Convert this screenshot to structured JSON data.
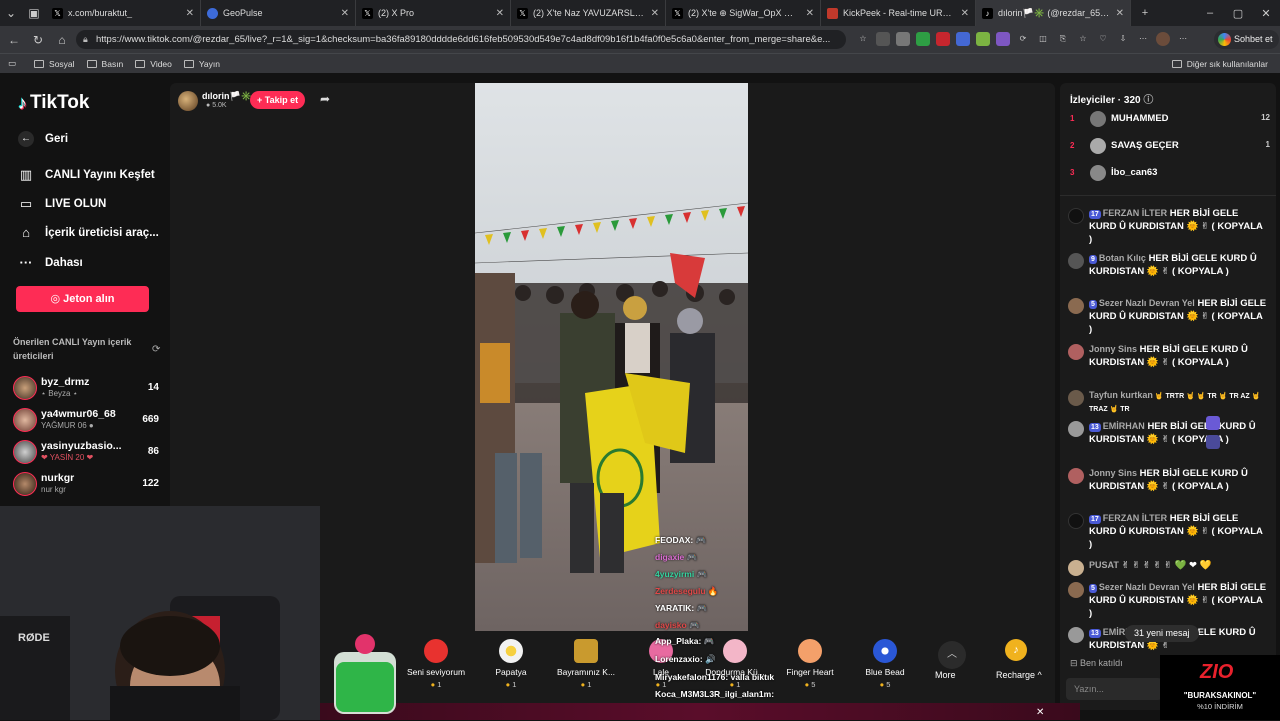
{
  "browser": {
    "tabs": [
      {
        "title": "x.com/buraktut_",
        "icon": "x-icon"
      },
      {
        "title": "GeoPulse",
        "icon": "globe-icon"
      },
      {
        "title": "(2) X Pro",
        "icon": "x-icon"
      },
      {
        "title": "(2) X'te Naz YAVUZARSLAN: \"CH",
        "icon": "x-icon"
      },
      {
        "title": "(2) X'te ⊕ SigWar_OpX ⊕ Δ: \"Ca",
        "icon": "x-icon"
      },
      {
        "title": "KickPeek - Real-time URL Crawle",
        "icon": "kickpeek-icon"
      },
      {
        "title": "dılorin🏳️✳️ (@rezdar_65) C",
        "icon": "tiktok-icon",
        "active": true
      }
    ],
    "url": "https://www.tiktok.com/@rezdar_65/live?_r=1&_sig=1&checksum=ba36fa89180dddde6dd616feb509530d549e7c4ad8df09b16f1b4fa0f0e5c6a0&enter_from_merge=share&e...",
    "chat_button": "Sohbet et",
    "bookmarks": [
      "Sosyal",
      "Basın",
      "Video",
      "Yayın"
    ],
    "other_bookmarks": "Diğer sık kullanılanlar"
  },
  "sidebar": {
    "logo": "TikTok",
    "items": [
      {
        "label": "Geri",
        "icon": "arrow-left-icon"
      },
      {
        "label": "CANLI Yayını Keşfet",
        "icon": "live-explore-icon"
      },
      {
        "label": "LIVE OLUN",
        "icon": "video-camera-icon"
      },
      {
        "label": "İçerik üreticisi araç...",
        "icon": "home-creator-icon"
      },
      {
        "label": "Dahası",
        "icon": "more-dots-icon"
      }
    ],
    "jeton_button": "Jeton alın",
    "suggest_title": "Önerilen CANLI Yayın içerik üreticileri",
    "creators": [
      {
        "name": "byz_drmz",
        "sub": "⋆ Beyza ⋆",
        "count": "14"
      },
      {
        "name": "ya4wmur06_68",
        "sub": "YAĞMUR 06 ●",
        "count": "669"
      },
      {
        "name": "yasinyuzbasio...",
        "sub": "❤ YASİN 20 ❤",
        "count": "86"
      },
      {
        "name": "nurkgr",
        "sub": "nur kgr",
        "count": "122"
      }
    ]
  },
  "stream": {
    "host_name": "dılorin🏳️✳️",
    "host_viewers": "5.0K",
    "follow_button": "+ Takip et",
    "video_chat": [
      {
        "text": "FEODAX: 🎮",
        "color": "#ffffff"
      },
      {
        "text": "digaxie 🎮",
        "color": "#d86ad0"
      },
      {
        "text": "4yuzyirmi 🎮",
        "color": "#34d3a0"
      },
      {
        "text": "Zerdesegulu 🔥",
        "color": "#e04848"
      },
      {
        "text": "YARATIK: 🎮",
        "color": "#ffffff"
      },
      {
        "text": "dayisko 🎮",
        "color": "#e04848"
      },
      {
        "text": "App_Plaka: 🎮",
        "color": "#ffffff"
      },
      {
        "text": "Lorenzaxio: 🔊",
        "color": "#ffffff"
      },
      {
        "text": "Miryakefalon1176: valla bıktık",
        "color": "#ffffff"
      },
      {
        "text": "Koca_M3M3L3R_ilgi_alan1m:",
        "color": "#ffffff"
      }
    ],
    "gifts": [
      {
        "name": "Seni seviyorum",
        "price": "1",
        "color": "#e8322f"
      },
      {
        "name": "Papatya",
        "price": "1",
        "color": "#f2f2f2"
      },
      {
        "name": "Bayramınız K...",
        "price": "1",
        "color": "#c99a2e"
      },
      {
        "name": "Lale",
        "price": "1",
        "color": "#e86aa0"
      },
      {
        "name": "Dondurma Kü...",
        "price": "1",
        "color": "#f3b6c8"
      },
      {
        "name": "Finger Heart",
        "price": "5",
        "color": "#f4a06a"
      },
      {
        "name": "Blue Bead",
        "price": "5",
        "color": "#2a57d6"
      }
    ],
    "more_label": "More",
    "recharge_label": "Recharge"
  },
  "viewers": {
    "title": "İzleyiciler · 320",
    "top": [
      {
        "rank": "1",
        "name": "MUHAMMED",
        "score": "12"
      },
      {
        "rank": "2",
        "name": "SAVAŞ GEÇER",
        "score": "1"
      },
      {
        "rank": "3",
        "name": "İbo_can63",
        "score": ""
      }
    ]
  },
  "chat": {
    "messages": [
      {
        "user": "FERZAN İLTER",
        "badge": "17",
        "text": "HER BİJİ GELE KURD Û KURDISTAN 🌞 ✌ ( KOPYALA )"
      },
      {
        "user": "Botan Kılıç",
        "badge": "9",
        "text": "HER BİJİ GELE KURD Û KURDISTAN 🌞 ✌ ( KOPYALA )"
      },
      {
        "user": "Sezer Nazlı Devran Yel",
        "badge": "5",
        "text": "HER BİJİ GELE KURD Û KURDISTAN 🌞 ✌ ( KOPYALA )"
      },
      {
        "user": "Jonny Sins",
        "badge": "",
        "text": "HER BİJİ GELE KURD Û KURDISTAN 🌞 ✌ ( KOPYALA )"
      },
      {
        "user": "Tayfun kurtkan",
        "badge": "",
        "text": "🤘 TRTR 🤘 🤘 TR 🤘 TR AZ 🤘 TRAZ 🤘 TR"
      },
      {
        "user": "EMİRHAN",
        "badge": "13",
        "text": "HER BİJİ GELE KURD Û KURDISTAN 🌞 ✌ ( KOPYALA )"
      },
      {
        "user": "Jonny Sins",
        "badge": "",
        "text": "HER BİJİ GELE KURD Û KURDISTAN 🌞 ✌ ( KOPYALA )"
      },
      {
        "user": "FERZAN İLTER",
        "badge": "17",
        "text": "HER BİJİ GELE KURD Û KURDISTAN 🌞 ✌ ( KOPYALA )"
      },
      {
        "user": "PUSAT",
        "badge": "",
        "text": "✌ ✌ ✌ ✌ ✌ 💚 ❤ 💛"
      },
      {
        "user": "Sezer Nazlı Devran Yel",
        "badge": "5",
        "text": "HER BİJİ GELE KURD Û KURDISTAN 🌞 ✌ ( KOPYALA )"
      },
      {
        "user": "EMİRHAN",
        "badge": "13",
        "text": "HER BİJİ GELE KURD Û KURDISTAN 🌞 ✌"
      }
    ],
    "new_messages": "31 yeni mesaj",
    "join_line": "Ben katıldı",
    "input_placeholder": "Yazın..."
  },
  "overlay": {
    "promo_brand": "ZIO",
    "promo_line1": "\"BURAKSAKINOL\"",
    "promo_line2": "%10 İNDİRİM",
    "mic_brand": "RØDE"
  }
}
